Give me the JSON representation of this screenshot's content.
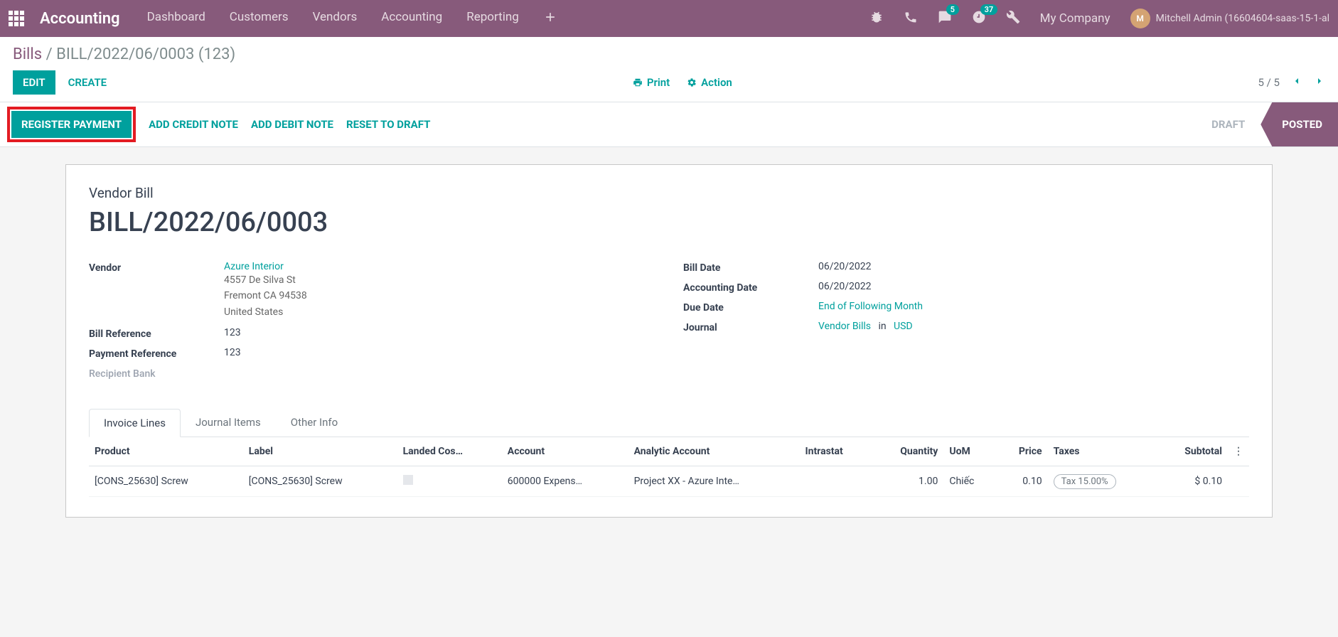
{
  "nav": {
    "brand": "Accounting",
    "items": [
      "Dashboard",
      "Customers",
      "Vendors",
      "Accounting",
      "Reporting"
    ],
    "badge_msg": "5",
    "badge_act": "37",
    "company": "My Company",
    "user": "Mitchell Admin (16604604-saas-15-1-al",
    "avatar_initials": "M"
  },
  "breadcrumb": {
    "root": "Bills",
    "current": "BILL/2022/06/0003 (123)"
  },
  "cp": {
    "edit": "EDIT",
    "create": "CREATE",
    "print": "Print",
    "action": "Action",
    "pager": "5 / 5"
  },
  "status_buttons": {
    "register": "REGISTER PAYMENT",
    "credit": "ADD CREDIT NOTE",
    "debit": "ADD DEBIT NOTE",
    "reset": "RESET TO DRAFT"
  },
  "statusbar": {
    "draft": "DRAFT",
    "posted": "POSTED"
  },
  "doc": {
    "subtitle": "Vendor Bill",
    "title": "BILL/2022/06/0003",
    "labels": {
      "vendor": "Vendor",
      "bill_ref": "Bill Reference",
      "pay_ref": "Payment Reference",
      "bank": "Recipient Bank",
      "bill_date": "Bill Date",
      "acc_date": "Accounting Date",
      "due_date": "Due Date",
      "journal": "Journal"
    },
    "vendor_name": "Azure Interior",
    "vendor_addr": [
      "4557 De Silva St",
      "Fremont CA 94538",
      "United States"
    ],
    "bill_ref": "123",
    "pay_ref": "123",
    "bill_date": "06/20/2022",
    "acc_date": "06/20/2022",
    "due_date": "End of Following Month",
    "journal_name": "Vendor Bills",
    "journal_in": "in",
    "journal_cur": "USD"
  },
  "tabs": {
    "t1": "Invoice Lines",
    "t2": "Journal Items",
    "t3": "Other Info"
  },
  "table": {
    "headers": {
      "product": "Product",
      "label": "Label",
      "landed": "Landed Cos…",
      "account": "Account",
      "analytic": "Analytic Account",
      "intrastat": "Intrastat",
      "qty": "Quantity",
      "uom": "UoM",
      "price": "Price",
      "taxes": "Taxes",
      "subtotal": "Subtotal"
    },
    "row": {
      "product": "[CONS_25630] Screw",
      "label": "[CONS_25630] Screw",
      "account": "600000 Expens…",
      "analytic": "Project XX - Azure Inte…",
      "qty": "1.00",
      "uom": "Chiếc",
      "price": "0.10",
      "tax": "Tax 15.00%",
      "subtotal": "$ 0.10"
    }
  }
}
